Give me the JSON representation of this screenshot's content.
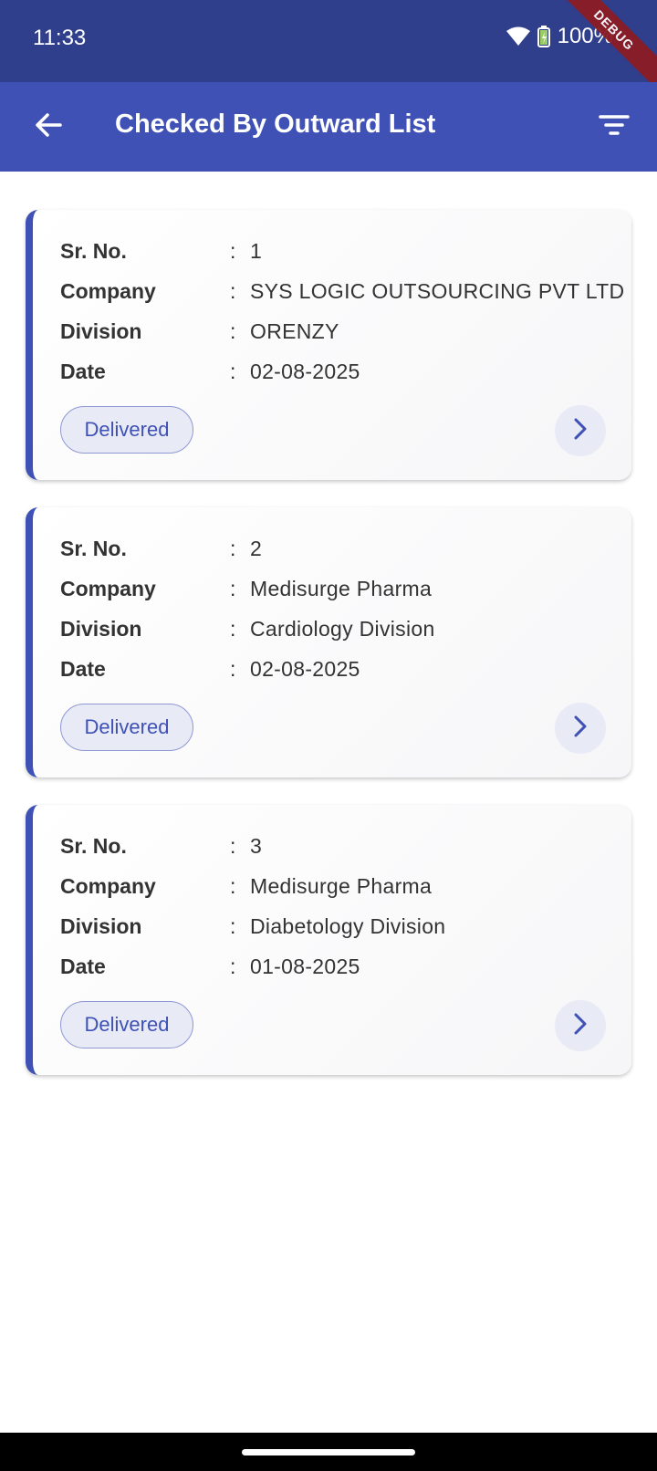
{
  "status_bar": {
    "time": "11:33",
    "battery": "100%",
    "debug_label": "DEBUG"
  },
  "app_bar": {
    "title": "Checked By Outward List"
  },
  "labels": {
    "sr_no": "Sr. No.",
    "company": "Company",
    "division": "Division",
    "date": "Date",
    "colon": ":"
  },
  "cards": [
    {
      "sr_no": "1",
      "company": "SYS LOGIC OUTSOURCING PVT LTD",
      "division": "ORENZY",
      "date": "02-08-2025",
      "status": "Delivered"
    },
    {
      "sr_no": "2",
      "company": "Medisurge Pharma",
      "division": "Cardiology Division",
      "date": "02-08-2025",
      "status": "Delivered"
    },
    {
      "sr_no": "3",
      "company": "Medisurge Pharma",
      "division": "Diabetology Division",
      "date": "01-08-2025",
      "status": "Delivered"
    }
  ],
  "colors": {
    "primary": "#3f51b5",
    "status_bar": "#2f3f8c",
    "chip_bg": "#e8eaf6"
  }
}
